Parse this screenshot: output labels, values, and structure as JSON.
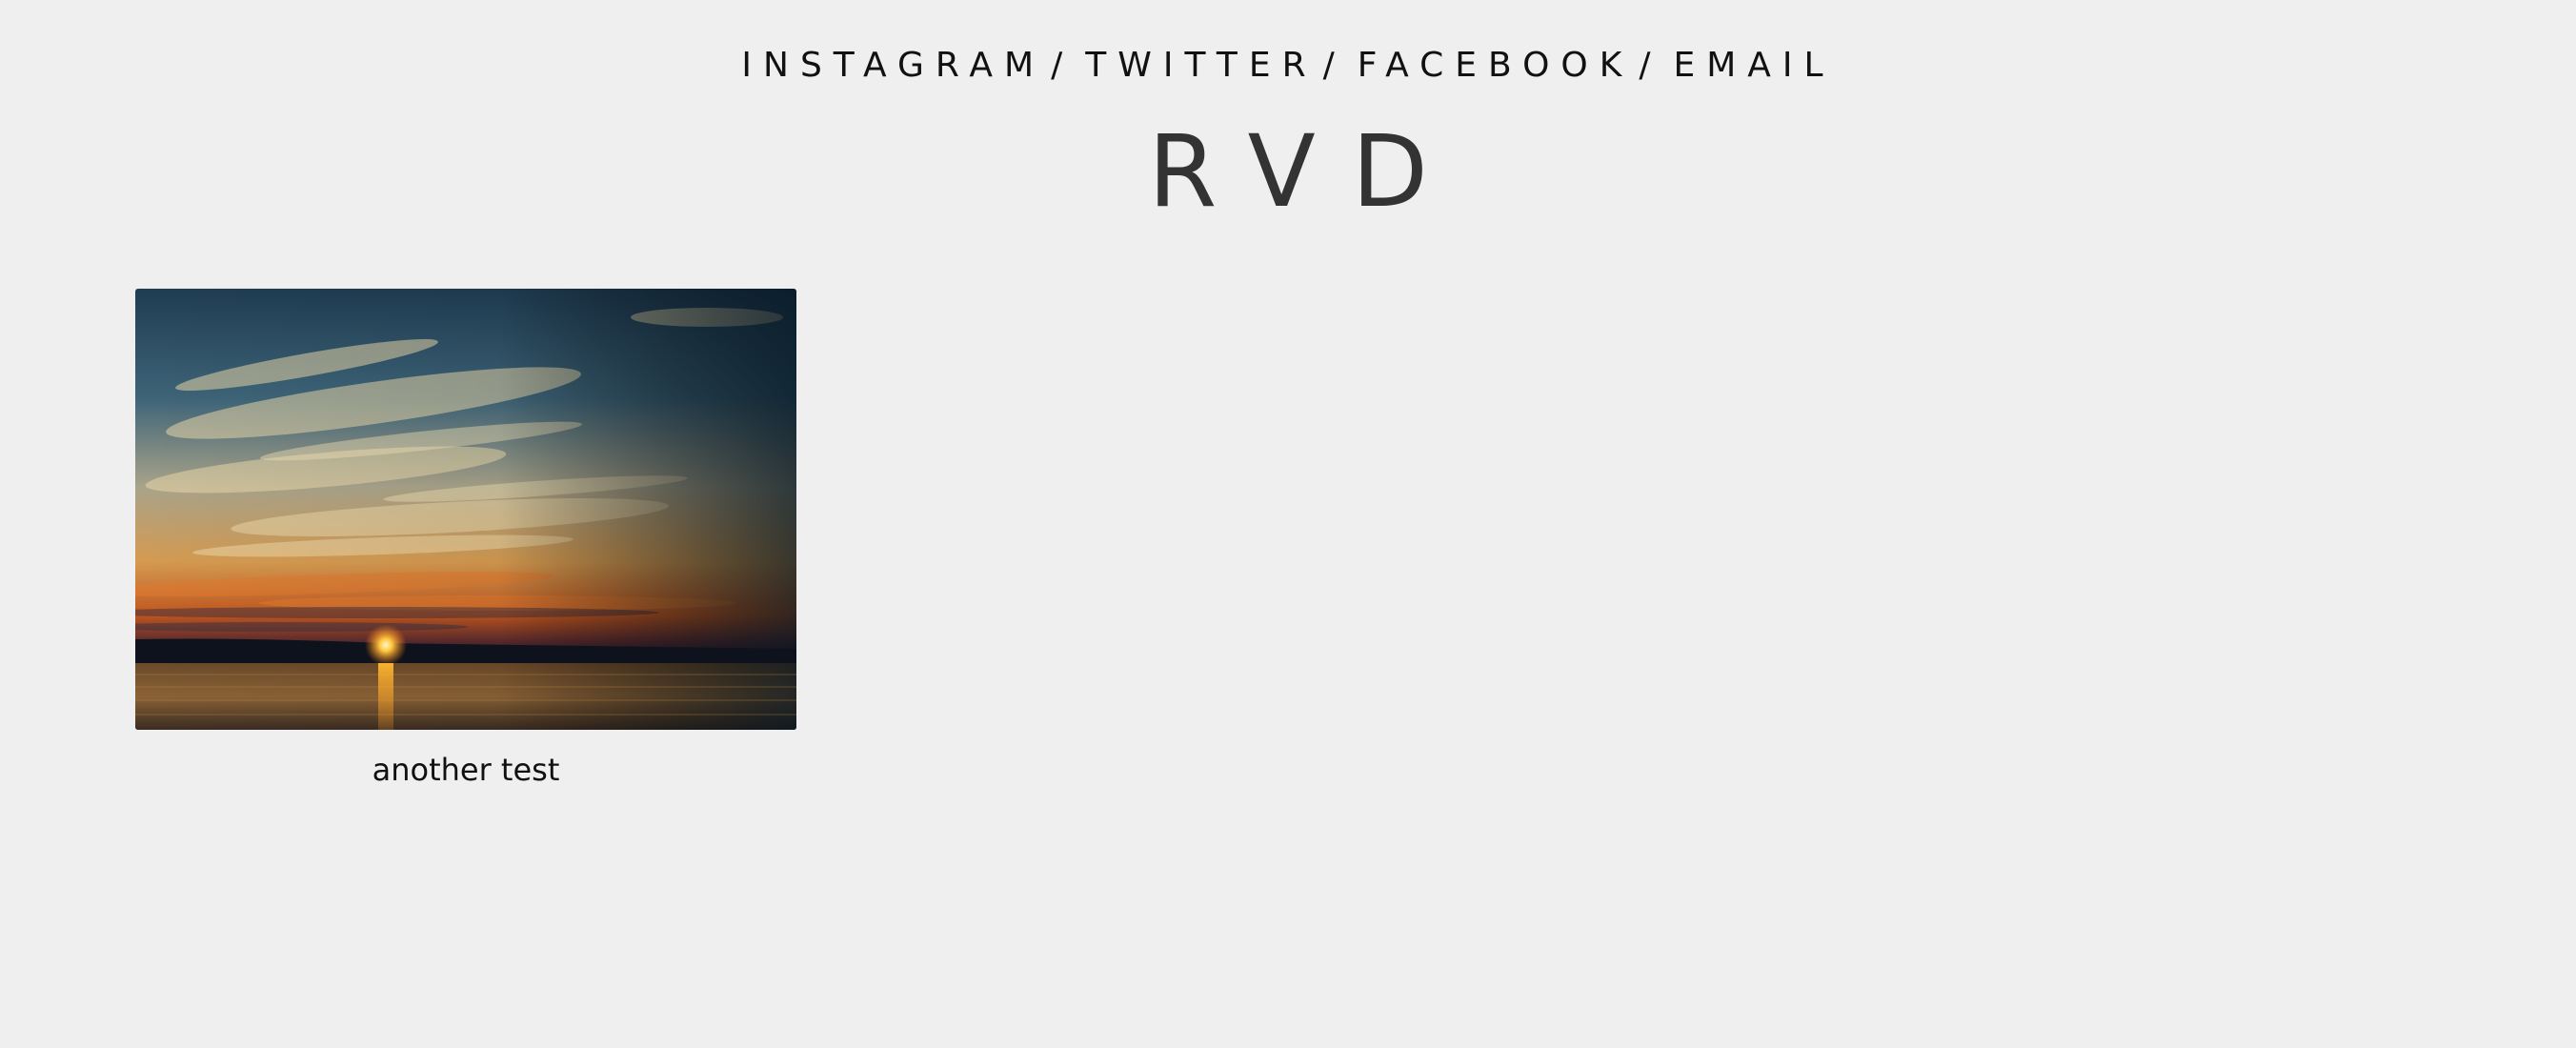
{
  "header": {
    "social_links": [
      {
        "label": "INSTAGRAM"
      },
      {
        "label": "TWITTER"
      },
      {
        "label": "FACEBOOK"
      },
      {
        "label": "EMAIL"
      }
    ],
    "separator": "/",
    "site_title": "RVD"
  },
  "posts": [
    {
      "title": "another test",
      "image_icon": "sunset-photo"
    }
  ],
  "colors": {
    "background": "#efefef",
    "text": "#111111",
    "title": "#333333"
  }
}
